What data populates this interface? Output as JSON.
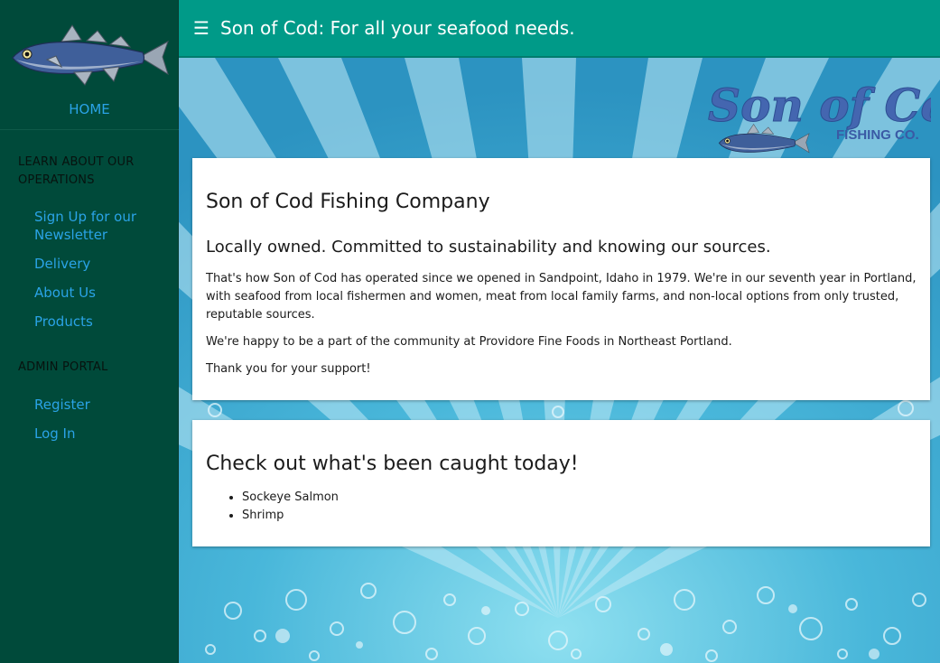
{
  "header": {
    "menu_glyph": "☰",
    "title": "Son of Cod: For all your seafood needs."
  },
  "sidebar": {
    "home_label": "HOME",
    "sections": [
      {
        "title": "LEARN ABOUT OUR OPERATIONS",
        "links": [
          {
            "label": "Sign Up for our Newsletter"
          },
          {
            "label": "Delivery"
          },
          {
            "label": "About Us"
          },
          {
            "label": "Products"
          }
        ]
      },
      {
        "title": "ADMIN PORTAL",
        "links": [
          {
            "label": "Register"
          },
          {
            "label": "Log In"
          }
        ]
      }
    ]
  },
  "brand": {
    "name": "Son of Cod",
    "tagline": "FISHING CO."
  },
  "main": {
    "card1": {
      "heading": "Son of Cod Fishing Company",
      "subheading": "Locally owned. Committed to sustainability and knowing our sources.",
      "paragraphs": [
        "That's how Son of Cod has operated since we opened in Sandpoint, Idaho in 1979. We're in our seventh year in Portland, with seafood from local fishermen and women, meat from local family farms, and non-local options from only trusted, reputable sources.",
        "We're happy to be a part of the community at Providore Fine Foods in Northeast Portland.",
        "Thank you for your support!"
      ]
    },
    "card2": {
      "heading": "Check out what's been caught today!",
      "items": [
        "Sockeye Salmon",
        "Shrimp"
      ]
    }
  },
  "colors": {
    "topbar": "#009a88",
    "sidebar": "#004a3a",
    "link": "#2aa3e6"
  },
  "icons": {
    "menu": "hamburger-icon",
    "logo": "fish-icon"
  }
}
